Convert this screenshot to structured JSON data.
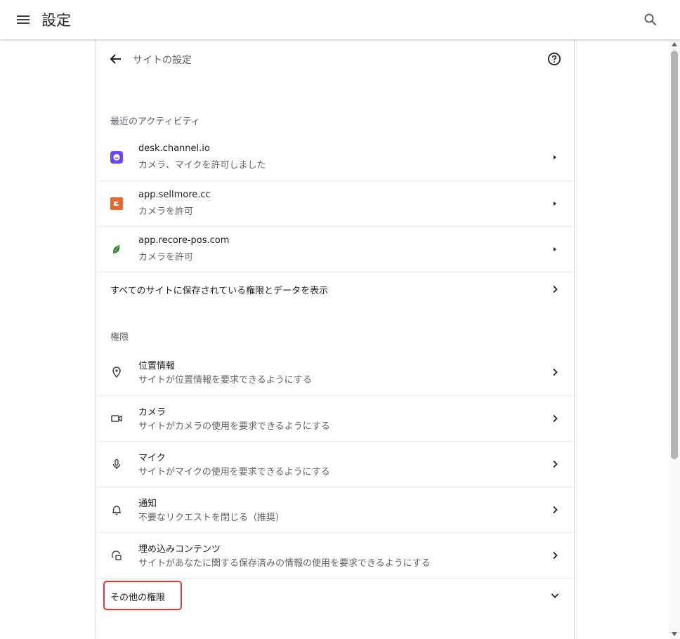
{
  "header": {
    "title": "設定"
  },
  "subheader": {
    "title": "サイトの設定"
  },
  "recent": {
    "label": "最近のアクティビティ",
    "items": [
      {
        "site": "desk.channel.io",
        "detail": "カメラ、マイクを許可しました",
        "favicon_color": "#6c47ff"
      },
      {
        "site": "app.sellmore.cc",
        "detail": "カメラを許可",
        "favicon_color": "#e8672c"
      },
      {
        "site": "app.recore-pos.com",
        "detail": "カメラを許可",
        "favicon_color": "#2e7d32"
      }
    ],
    "view_all": "すべてのサイトに保存されている権限とデータを表示"
  },
  "permissions": {
    "label": "権限",
    "items": [
      {
        "title": "位置情報",
        "desc": "サイトが位置情報を要求できるようにする",
        "icon": "location-pin-icon"
      },
      {
        "title": "カメラ",
        "desc": "サイトがカメラの使用を要求できるようにする",
        "icon": "camera-icon"
      },
      {
        "title": "マイク",
        "desc": "サイトがマイクの使用を要求できるようにする",
        "icon": "microphone-icon"
      },
      {
        "title": "通知",
        "desc": "不要なリクエストを閉じる（推奨）",
        "icon": "bell-icon"
      },
      {
        "title": "埋め込みコンテンツ",
        "desc": "サイトがあなたに関する保存済みの情報の使用を要求できるようにする",
        "icon": "embedded-content-icon"
      }
    ],
    "more": "その他の権限"
  },
  "colors": {
    "highlight": "#e53935",
    "text_primary": "#202124",
    "text_secondary": "#5f6368"
  }
}
